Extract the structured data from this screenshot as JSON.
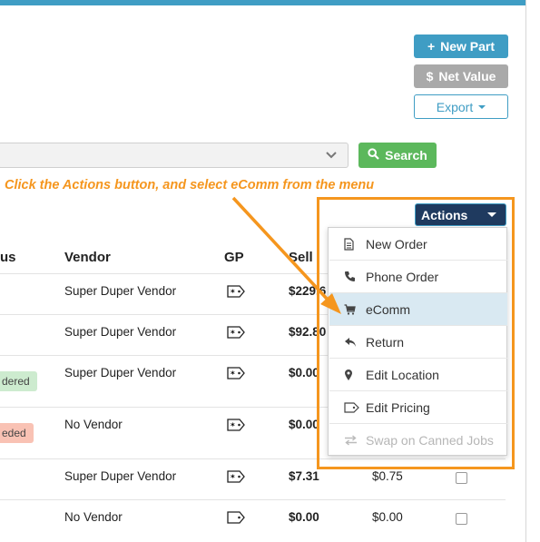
{
  "toolbar": {
    "new_part_label": "New Part",
    "net_value_label": "Net Value",
    "export_label": "Export"
  },
  "search": {
    "button_label": "Search"
  },
  "annotation": {
    "text": "Click the Actions button, and select eComm from the menu",
    "color": "#f5961e"
  },
  "actions": {
    "button_label": "Actions",
    "menu": [
      "New Order",
      "Phone Order",
      "eComm",
      "Return",
      "Edit Location",
      "Edit Pricing",
      "Swap on Canned Jobs"
    ],
    "active_item": "eComm",
    "disabled_item": "Swap on Canned Jobs"
  },
  "table": {
    "columns": {
      "status": "us",
      "vendor": "Vendor",
      "gp": "GP",
      "sell": "Sell"
    },
    "rows": [
      {
        "vendor": "Super Duper Vendor",
        "sell": "$229.6",
        "status": "",
        "col5": "",
        "checkbox": false
      },
      {
        "vendor": "Super Duper Vendor",
        "sell": "$92.80",
        "status": "",
        "col5": "",
        "checkbox": false
      },
      {
        "vendor": "Super Duper Vendor",
        "sell": "$0.00",
        "status": "dered",
        "col5": "",
        "checkbox": false
      },
      {
        "vendor": "No Vendor",
        "sell": "$0.00",
        "status": "eded",
        "col5": "",
        "checkbox": false
      },
      {
        "vendor": "Super Duper Vendor",
        "sell": "$7.31",
        "status": "",
        "col5": "$0.75",
        "checkbox": false
      },
      {
        "vendor": "No Vendor",
        "sell": "$0.00",
        "status": "",
        "col5": "$0.00",
        "checkbox": false
      }
    ]
  },
  "colors": {
    "primary": "#3f9dc4",
    "success": "#5cb85c",
    "actions_bg": "#1f3a5f",
    "highlight": "#f5961e"
  }
}
